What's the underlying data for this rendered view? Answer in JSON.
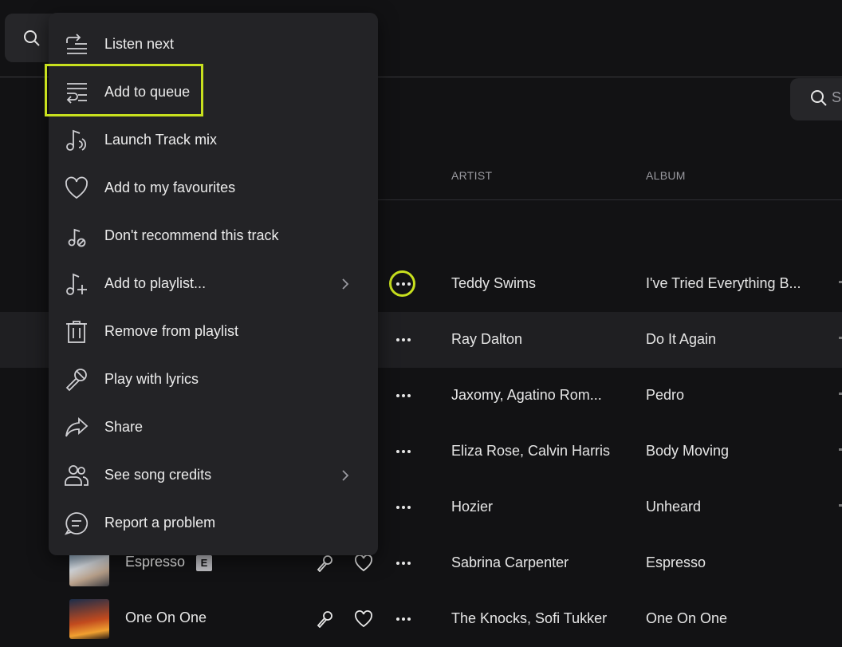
{
  "colors": {
    "background": "#121214",
    "menu": "#232326",
    "highlight": "#c8e01e",
    "text": "#ececec",
    "muted": "#9a9aa0"
  },
  "search": {
    "icon": "search-icon",
    "partial_text": "S"
  },
  "table": {
    "headers": {
      "artist": "ARTIST",
      "album": "ALBUM"
    }
  },
  "rows": [
    {
      "artist": "Teddy Swims",
      "album": "I've Tried Everything B..."
    },
    {
      "artist": "Ray Dalton",
      "album": "Do It Again"
    },
    {
      "artist": "Jaxomy, Agatino Rom...",
      "album": "Pedro"
    },
    {
      "artist": "Eliza Rose, Calvin Harris",
      "album": "Body Moving"
    },
    {
      "artist": "Hozier",
      "album": "Unheard"
    },
    {
      "title": "Espresso",
      "explicit": "E",
      "artist": "Sabrina Carpenter",
      "album": "Espresso"
    },
    {
      "title": "One On One",
      "artist": "The Knocks, Sofi Tukker",
      "album": "One On One"
    }
  ],
  "menu": {
    "items": [
      {
        "label": "Listen next",
        "icon": "listen-next-icon"
      },
      {
        "label": "Add to queue",
        "icon": "add-to-queue-icon"
      },
      {
        "label": "Launch Track mix",
        "icon": "track-mix-icon"
      },
      {
        "label": "Add to my favourites",
        "icon": "heart-icon"
      },
      {
        "label": "Don't recommend this track",
        "icon": "dont-recommend-icon"
      },
      {
        "label": "Add to playlist...",
        "icon": "add-to-playlist-icon",
        "submenu": true
      },
      {
        "label": "Remove from playlist",
        "icon": "trash-icon"
      },
      {
        "label": "Play with lyrics",
        "icon": "microphone-icon"
      },
      {
        "label": "Share",
        "icon": "share-icon"
      },
      {
        "label": "See song credits",
        "icon": "credits-icon",
        "submenu": true
      },
      {
        "label": "Report a problem",
        "icon": "report-icon"
      }
    ]
  }
}
